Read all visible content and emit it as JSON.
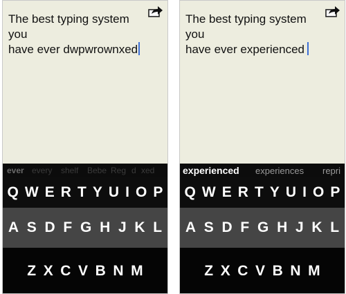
{
  "left": {
    "note": {
      "line1": "The best typing system you",
      "line2": "have ever dwpwrownxed"
    },
    "suggestions": [
      "ever",
      "every",
      "shelf",
      "Bebe",
      "Reg",
      "d",
      "xed"
    ]
  },
  "right": {
    "note": {
      "line1": "The best typing system you",
      "line2": "have ever experienced"
    },
    "suggestions": {
      "selected": "experienced",
      "second": "experiences",
      "third": "repri"
    }
  },
  "keyboard": {
    "row1": [
      "Q",
      "W",
      "E",
      "R",
      "T",
      "Y",
      "U",
      "I",
      "O",
      "P"
    ],
    "row2": [
      "A",
      "S",
      "D",
      "F",
      "G",
      "H",
      "J",
      "K",
      "L"
    ],
    "row3": [
      "Z",
      "X",
      "C",
      "V",
      "B",
      "N",
      "M"
    ]
  },
  "icons": {
    "share": "share-arrow-icon"
  },
  "colors": {
    "note_bg": "#ededdf",
    "caret": "#3d6fd6",
    "key_text": "#ffffff",
    "mid_row": "#454545"
  }
}
